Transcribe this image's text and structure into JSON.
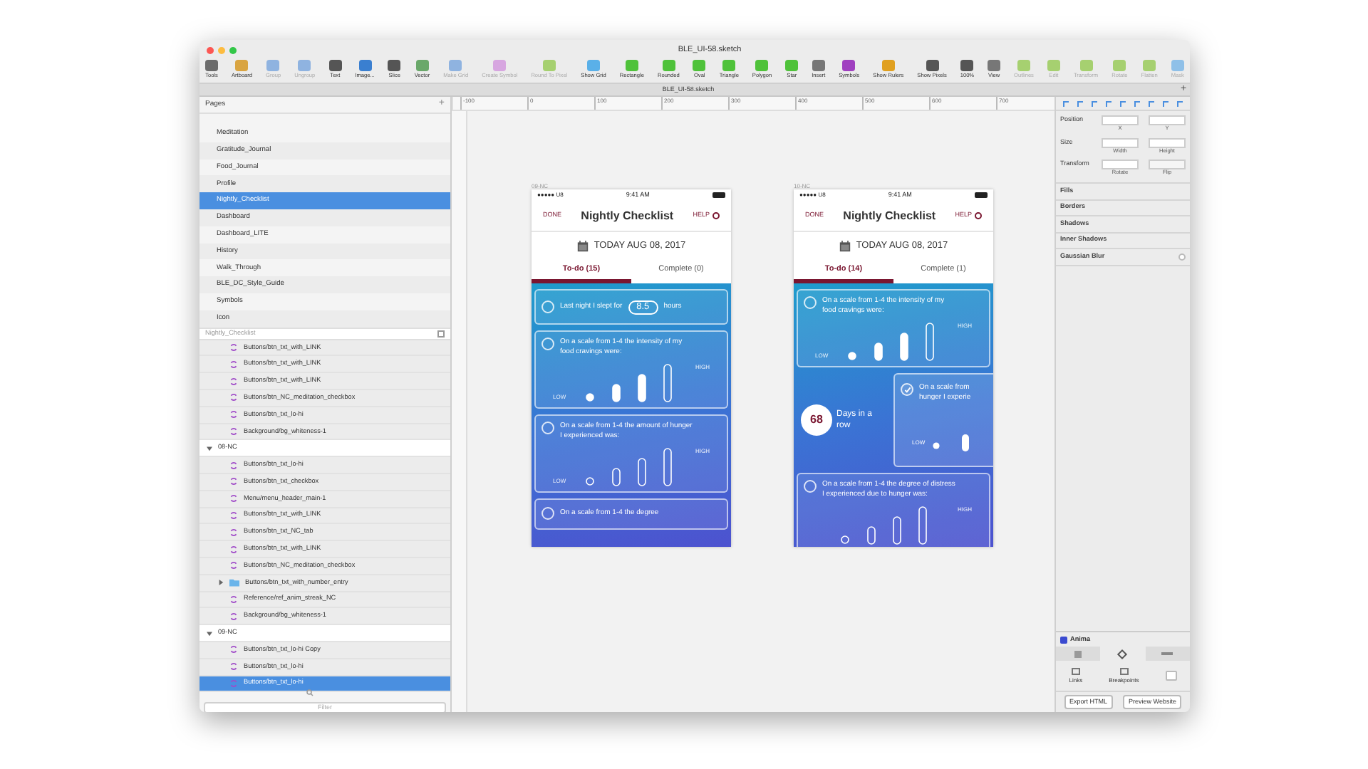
{
  "window": {
    "title": "BLE_UI-58.sketch",
    "tab": "BLE_UI-58.sketch",
    "add": "+"
  },
  "toolbar": [
    {
      "label": "Tools",
      "disabled": false,
      "color": "#6b6b6b"
    },
    {
      "label": "Artboard",
      "disabled": false,
      "color": "#d9a441"
    },
    {
      "label": "Group",
      "disabled": true,
      "color": "#8fb3e0"
    },
    {
      "label": "Ungroup",
      "disabled": true,
      "color": "#8fb3e0"
    },
    {
      "label": "Text",
      "disabled": false,
      "color": "#555555"
    },
    {
      "label": "Image...",
      "disabled": false,
      "color": "#3a7fd0"
    },
    {
      "label": "Slice",
      "disabled": false,
      "color": "#555555"
    },
    {
      "label": "Vector",
      "disabled": false,
      "color": "#6aa86a"
    },
    {
      "label": "Make Grid",
      "disabled": true,
      "color": "#8fb3e0"
    },
    {
      "label": "Create Symbol",
      "disabled": true,
      "color": "#d7a6e0"
    },
    {
      "label": "Round To Pixel",
      "disabled": true,
      "color": "#a6d070"
    },
    {
      "label": "Show Grid",
      "disabled": false,
      "color": "#5ab0e8"
    },
    {
      "label": "Rectangle",
      "disabled": false,
      "color": "#4fc23a"
    },
    {
      "label": "Rounded",
      "disabled": false,
      "color": "#4fc23a"
    },
    {
      "label": "Oval",
      "disabled": false,
      "color": "#4fc23a"
    },
    {
      "label": "Triangle",
      "disabled": false,
      "color": "#4fc23a"
    },
    {
      "label": "Polygon",
      "disabled": false,
      "color": "#4fc23a"
    },
    {
      "label": "Star",
      "disabled": false,
      "color": "#4fc23a"
    },
    {
      "label": "Insert",
      "disabled": false,
      "color": "#777777"
    },
    {
      "label": "Symbols",
      "disabled": false,
      "color": "#a040c0"
    },
    {
      "label": "Show Rulers",
      "disabled": false,
      "color": "#e0a020"
    },
    {
      "label": "Show Pixels",
      "disabled": false,
      "color": "#555555"
    },
    {
      "label": "100%",
      "disabled": false,
      "color": "#555555"
    },
    {
      "label": "View",
      "disabled": false,
      "color": "#777777"
    },
    {
      "label": "Outlines",
      "disabled": true,
      "color": "#a6d070"
    },
    {
      "label": "Edit",
      "disabled": true,
      "color": "#a6d070"
    },
    {
      "label": "Transform",
      "disabled": true,
      "color": "#a6d070"
    },
    {
      "label": "Rotate",
      "disabled": true,
      "color": "#a6d070"
    },
    {
      "label": "Flatten",
      "disabled": true,
      "color": "#a6d070"
    },
    {
      "label": "Mask",
      "disabled": true,
      "color": "#8fc0e8"
    }
  ],
  "pages": {
    "title": "Pages",
    "add": "+",
    "items": [
      {
        "label": "Meditation",
        "selected": false
      },
      {
        "label": "Gratitude_Journal",
        "selected": false
      },
      {
        "label": "Food_Journal",
        "selected": false
      },
      {
        "label": "Profile",
        "selected": false
      },
      {
        "label": "Nightly_Checklist",
        "selected": true
      },
      {
        "label": "Dashboard",
        "selected": false
      },
      {
        "label": "Dashboard_LITE",
        "selected": false
      },
      {
        "label": "History",
        "selected": false
      },
      {
        "label": "Walk_Through",
        "selected": false
      },
      {
        "label": "BLE_DC_Style_Guide",
        "selected": false
      },
      {
        "label": "Symbols",
        "selected": false
      },
      {
        "label": "Icon",
        "selected": false
      }
    ]
  },
  "layers": {
    "title": "Nightly_Checklist",
    "filter_placeholder": "Filter",
    "items": [
      {
        "kind": "symbol",
        "label": "Buttons/btn_txt_with_LINK",
        "selected": false
      },
      {
        "kind": "symbol",
        "label": "Buttons/btn_txt_with_LINK",
        "selected": false
      },
      {
        "kind": "symbol",
        "label": "Buttons/btn_txt_with_LINK",
        "selected": false
      },
      {
        "kind": "symbol",
        "label": "Buttons/btn_NC_meditation_checkbox",
        "selected": false
      },
      {
        "kind": "symbol",
        "label": "Buttons/btn_txt_lo-hi",
        "selected": false
      },
      {
        "kind": "symbol",
        "label": "Background/bg_whiteness-1",
        "selected": false
      },
      {
        "kind": "artboard",
        "label": "08-NC",
        "expanded": true,
        "selected": false,
        "children": [
          {
            "kind": "symbol",
            "label": "Buttons/btn_txt_lo-hi",
            "selected": false
          },
          {
            "kind": "symbol",
            "label": "Buttons/btn_txt_checkbox",
            "selected": false
          },
          {
            "kind": "symbol",
            "label": "Menu/menu_header_main-1",
            "selected": false
          },
          {
            "kind": "symbol",
            "label": "Buttons/btn_txt_with_LINK",
            "selected": false
          },
          {
            "kind": "symbol",
            "label": "Buttons/btn_txt_NC_tab",
            "selected": false
          },
          {
            "kind": "symbol",
            "label": "Buttons/btn_txt_with_LINK",
            "selected": false
          },
          {
            "kind": "symbol",
            "label": "Buttons/btn_NC_meditation_checkbox",
            "selected": false
          },
          {
            "kind": "folder",
            "label": "Buttons/btn_txt_with_number_entry",
            "expanded": false,
            "selected": false
          },
          {
            "kind": "symbol",
            "label": "Reference/ref_anim_streak_NC",
            "selected": false
          },
          {
            "kind": "symbol",
            "label": "Background/bg_whiteness-1",
            "selected": false
          }
        ]
      },
      {
        "kind": "artboard",
        "label": "09-NC",
        "expanded": true,
        "selected": false,
        "children": [
          {
            "kind": "symbol",
            "label": "Buttons/btn_txt_lo-hi Copy",
            "selected": false
          },
          {
            "kind": "symbol",
            "label": "Buttons/btn_txt_lo-hi",
            "selected": false
          },
          {
            "kind": "symbol",
            "label": "Buttons/btn_txt_lo-hi",
            "selected": true
          }
        ]
      }
    ]
  },
  "ruler": [
    "-100",
    "0",
    "100",
    "200",
    "300",
    "400",
    "500",
    "600",
    "700"
  ],
  "artboards": [
    {
      "label": "09-NC",
      "carrier": "●●●●● U8",
      "time": "9:41 AM",
      "done": "DONE",
      "title": "Nightly Checklist",
      "help": "HELP",
      "date": "TODAY AUG 08, 2017",
      "tabs": [
        {
          "label": "To-do (15)",
          "selected": true
        },
        {
          "label": "Complete (0)",
          "selected": false
        }
      ],
      "cards": [
        {
          "kind": "entry",
          "checked": false,
          "before": "Last night I slept for",
          "value": "8.5",
          "after": "hours"
        },
        {
          "kind": "scale",
          "checked": false,
          "text": "On a scale from 1-4 the intensity of my food cravings were:",
          "low": "LOW",
          "high": "HIGH",
          "marked": true
        },
        {
          "kind": "scale",
          "checked": false,
          "text": "On a scale from 1-4 the amount of hunger I experienced was:",
          "low": "LOW",
          "high": "HIGH",
          "marked": false
        },
        {
          "kind": "text",
          "checked": false,
          "text": "On a scale from 1-4 the degree"
        }
      ]
    },
    {
      "label": "10-NC",
      "carrier": "●●●●● U8",
      "time": "9:41 AM",
      "done": "DONE",
      "title": "Nightly Checklist",
      "help": "HELP",
      "date": "TODAY AUG 08, 2017",
      "tabs": [
        {
          "label": "To-do (14)",
          "selected": true
        },
        {
          "label": "Complete (1)",
          "selected": false
        }
      ],
      "cards": [
        {
          "kind": "scale",
          "checked": false,
          "text": "On a scale from 1-4 the intensity of my food cravings were:",
          "low": "LOW",
          "high": "HIGH",
          "marked": true
        },
        {
          "kind": "streak",
          "number": "68",
          "text": "Days in a row",
          "card": {
            "checked": true,
            "text": "On a scale from hunger I experie",
            "low": "LOW"
          }
        },
        {
          "kind": "scale",
          "checked": false,
          "text": "On a scale from 1-4 the degree of distress I experienced due to hunger was:",
          "high": "HIGH",
          "marked": false
        }
      ]
    }
  ],
  "inspector": {
    "position": "Position",
    "x": "X",
    "y": "Y",
    "size": "Size",
    "width": "Width",
    "height": "Height",
    "transform": "Transform",
    "rotate": "Rotate",
    "flip": "Flip",
    "sections": [
      "Fills",
      "Borders",
      "Shadows",
      "Inner Shadows"
    ],
    "blur": "Gaussian Blur",
    "blur_checked": false
  },
  "anima": {
    "title": "Anima",
    "links": "Links",
    "breakpoints": "Breakpoints",
    "export": "Export HTML",
    "preview": "Preview Website"
  }
}
